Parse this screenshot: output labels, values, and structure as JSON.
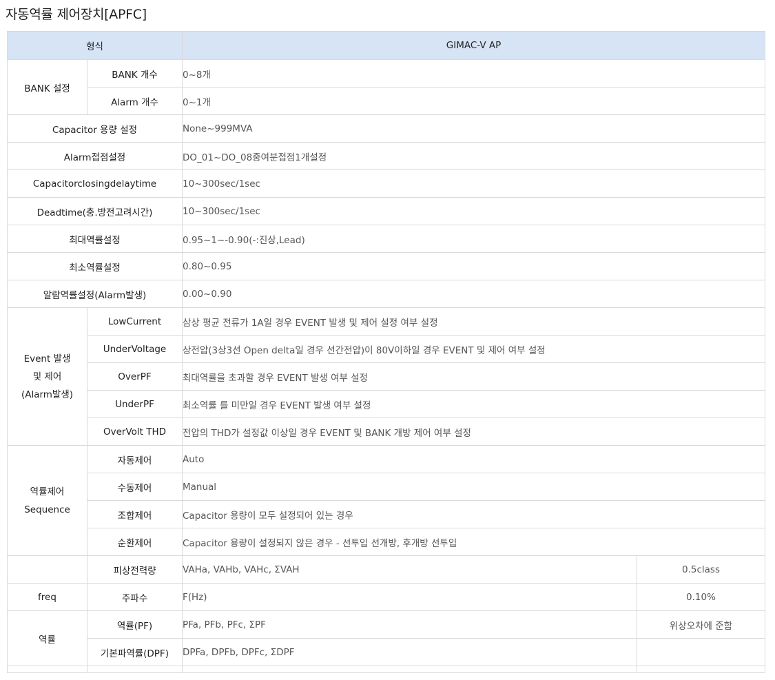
{
  "title": "자동역률 제어장치[APFC]",
  "header": {
    "col1": "형식",
    "col2": "GIMAC-V AP"
  },
  "bank": {
    "group": "BANK 설정",
    "rows": [
      {
        "label": "BANK 개수",
        "value": "0~8개"
      },
      {
        "label": "Alarm 개수",
        "value": "0~1개"
      }
    ]
  },
  "simple_rows": [
    {
      "label": "Capacitor 용량 설정",
      "value": "None~999MVA"
    },
    {
      "label": "Alarm접점설정",
      "value": "DO_01~DO_08중여분접점1개설정"
    },
    {
      "label": "Capacitorclosingdelaytime",
      "value": "10~300sec/1sec"
    },
    {
      "label": "Deadtime(충.방전고려시간)",
      "value": "10~300sec/1sec"
    },
    {
      "label": "최대역률설정",
      "value": "0.95~1~-0.90(-:진상,Lead)"
    },
    {
      "label": "최소역률설정",
      "value": "0.80~0.95"
    },
    {
      "label": "알람역률설정(Alarm발생)",
      "value": "0.00~0.90"
    }
  ],
  "event": {
    "group_line1": "Event 발생",
    "group_line2": "및 제어",
    "group_line3": "(Alarm발생)",
    "rows": [
      {
        "label": "LowCurrent",
        "value": "삼상 평균 전류가 1A일 경우 EVENT 발생 및 제어 설정 여부 설정"
      },
      {
        "label": "UnderVoltage",
        "value": "상전압(3상3선 Open delta일 경우 선간전압)이 80V이하일 경우 EVENT 및 제어 여부 설정"
      },
      {
        "label": "OverPF",
        "value": "최대역률을 초과할 경우 EVENT 발생 여부 설정"
      },
      {
        "label": "UnderPF",
        "value": "최소역률 를 미만일 경우 EVENT 발생 여부 설정"
      },
      {
        "label": "OverVolt THD",
        "value": "전압의 THD가 설정값 이상일 경우 EVENT 및 BANK 개방 제어 여부 설정"
      }
    ]
  },
  "sequence": {
    "group_line1": "역률제어",
    "group_line2": "Sequence",
    "rows": [
      {
        "label": "자동제어",
        "value": "Auto"
      },
      {
        "label": "수동제어",
        "value": "Manual"
      },
      {
        "label": "조합제어",
        "value": "Capacitor 용량이 모두 설정되어 있는 경우"
      },
      {
        "label": "순환제어",
        "value": "Capacitor 용량이 설정되지 않은 경우 - 선투입 선개방, 후개방 선투입"
      }
    ]
  },
  "measure": {
    "apparent": {
      "group": "",
      "label": "피상전력량",
      "value": "VAHa, VAHb, VAHc, ΣVAH",
      "accuracy": "0.5class"
    },
    "freq": {
      "group": "freq",
      "label": "주파수",
      "value": "F(Hz)",
      "accuracy": "0.10%"
    },
    "pf": {
      "group": "역률",
      "rows": [
        {
          "label": "역률(PF)",
          "value": "PFa, PFb, PFc, ΣPF",
          "accuracy": "위상오차에 준함"
        },
        {
          "label": "기본파역률(DPF)",
          "value": "DPFa, DPFb, DPFc, ΣDPF",
          "accuracy": ""
        }
      ]
    }
  }
}
